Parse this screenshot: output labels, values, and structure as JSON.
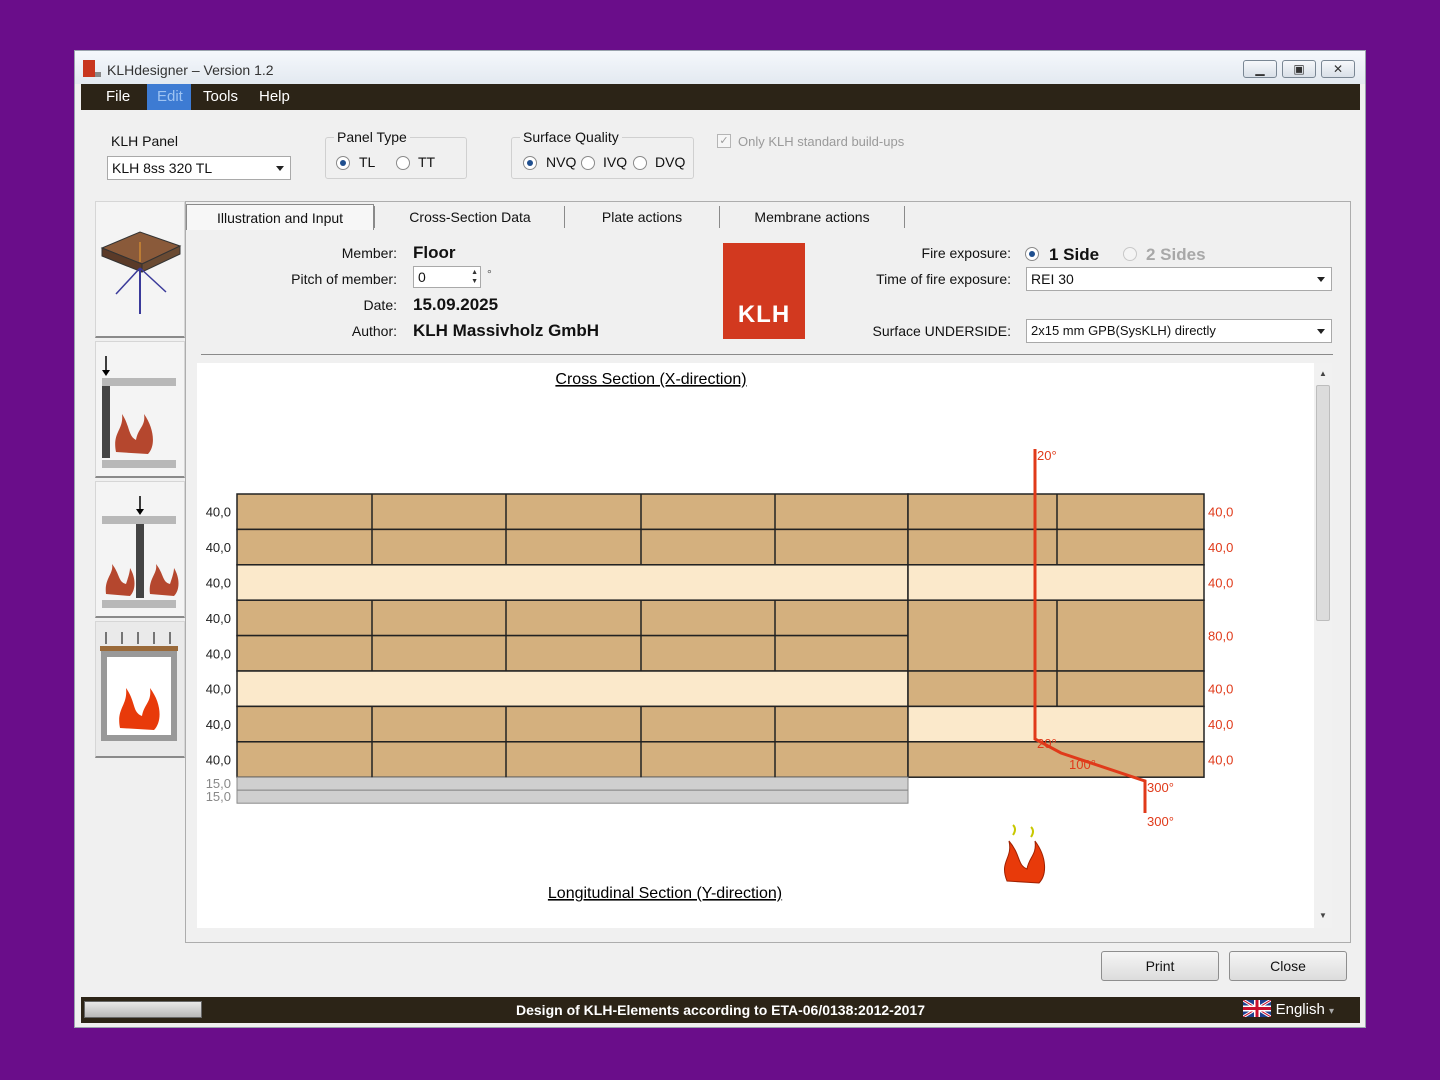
{
  "window": {
    "title": "KLHdesigner – Version 1.2"
  },
  "menu": {
    "items": [
      "File",
      "Edit",
      "Tools",
      "Help"
    ],
    "active": "Edit"
  },
  "klh_panel": {
    "label": "KLH Panel",
    "value": "KLH 8ss 320 TL"
  },
  "panel_type": {
    "label": "Panel Type",
    "options": [
      "TL",
      "TT"
    ],
    "selected": "TL"
  },
  "surface_quality": {
    "label": "Surface Quality",
    "options": [
      "NVQ",
      "IVQ",
      "DVQ"
    ],
    "selected": "NVQ"
  },
  "standard_buildups": {
    "label": "Only KLH standard build-ups",
    "checked": true
  },
  "tabs": [
    "Illustration and Input",
    "Cross-Section Data",
    "Plate actions",
    "Membrane actions"
  ],
  "active_tab": "Illustration and Input",
  "info": {
    "member_label": "Member:",
    "member_value": "Floor",
    "pitch_label": "Pitch of member:",
    "pitch_value": "0",
    "pitch_unit": "°",
    "date_label": "Date:",
    "date_value": "15.09.2025",
    "author_label": "Author:",
    "author_value": "KLH Massivholz GmbH"
  },
  "logo": {
    "text": "KLH",
    "color": "#d2391f"
  },
  "fire": {
    "exposure_label": "Fire exposure:",
    "options": [
      "1 Side",
      "2 Sides"
    ],
    "selected": "1 Side",
    "time_label": "Time of fire exposure:",
    "time_value": "REI 30",
    "surface_label": "Surface UNDERSIDE:",
    "surface_value": "2x15 mm GPB(SysKLH) directly"
  },
  "cross_section": {
    "title": "Cross Section (X-direction)",
    "layer_labels_left": [
      "40,0",
      "40,0",
      "40,0",
      "40,0",
      "40,0",
      "40,0",
      "40,0",
      "40,0",
      "15,0",
      "15,0"
    ],
    "layer_labels_right": [
      "40,0",
      "40,0",
      "40,0",
      "80,0",
      "40,0",
      "40,0",
      "40,0"
    ],
    "temperatures": [
      "20°",
      "20°",
      "100°",
      "300°",
      "300°"
    ],
    "longitudinal_title": "Longitudinal Section (Y-direction)",
    "colors": {
      "wood": "#d4b07e",
      "light": "#fbe9cb",
      "gypsum": "#cfcfcf",
      "temp_line": "#e03a1a"
    }
  },
  "buttons": {
    "print": "Print",
    "close": "Close"
  },
  "status": {
    "text": "Design of KLH-Elements according to ETA-06/0138:2012-2017",
    "language": "English"
  }
}
